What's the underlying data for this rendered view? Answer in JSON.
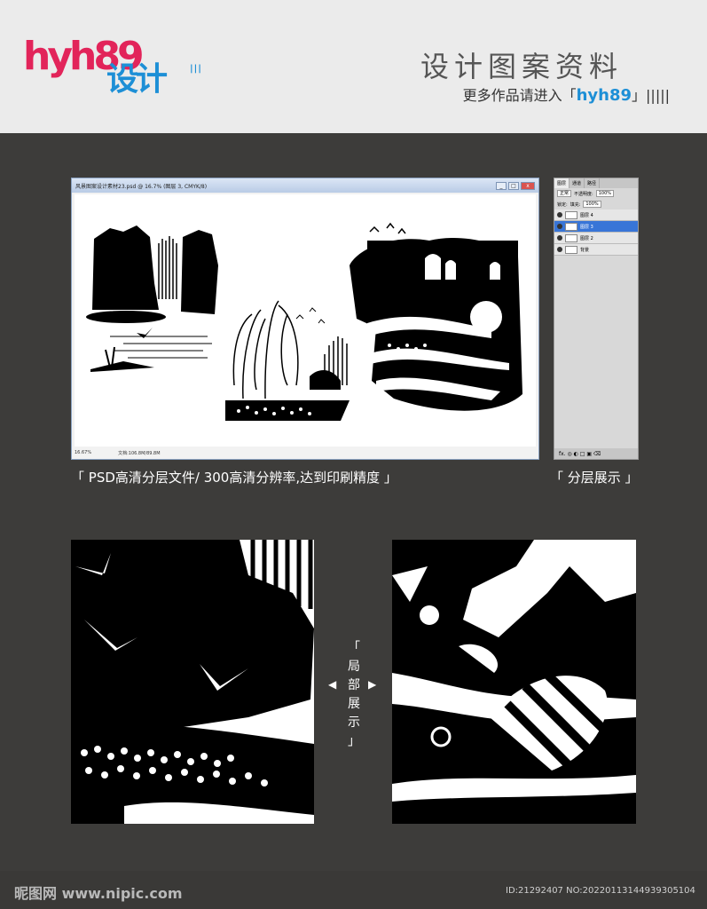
{
  "header": {
    "logo_en": "hyh89",
    "logo_cn": "设计",
    "logo_ticks": "|||",
    "title": "设计图案资料",
    "subtitle_prefix": "更多作品请进入「",
    "subtitle_highlight": "hyh89",
    "subtitle_suffix": "」|||||"
  },
  "ps_window": {
    "title": "风景图案设计素材23.psd @ 16.7% (图层 3, CMYK/8)",
    "zoom": "16.67%",
    "doc_size": "文档:106.8M/89.8M",
    "btn_min": "_",
    "btn_max": "□",
    "btn_close": "x"
  },
  "layers_panel": {
    "tabs": [
      "图层",
      "通道",
      "路径"
    ],
    "blend_mode": "正常",
    "opacity_label": "不透明度:",
    "opacity_value": "100%",
    "lock_label": "锁定:",
    "fill_label": "填充:",
    "fill_value": "100%",
    "layers": [
      {
        "name": "图层 4",
        "selected": false
      },
      {
        "name": "图层 3",
        "selected": true
      },
      {
        "name": "图层 2",
        "selected": false
      },
      {
        "name": "背景",
        "selected": false
      }
    ],
    "footer_icons": "fx. ◎ ◐ □ ▣ ⌫"
  },
  "captions": {
    "left": "「 PSD高清分层文件/ 300高清分辨率,达到印刷精度 」",
    "right": "「 分层展示 」"
  },
  "detail": {
    "label_chars": [
      "「",
      "局",
      "部",
      "展",
      "示",
      "」"
    ],
    "arrow_left": "◀",
    "arrow_right": "▶"
  },
  "watermark": {
    "left": "昵图网 www.nipic.com",
    "right": "ID:21292407 NO:20220113144939305104"
  }
}
